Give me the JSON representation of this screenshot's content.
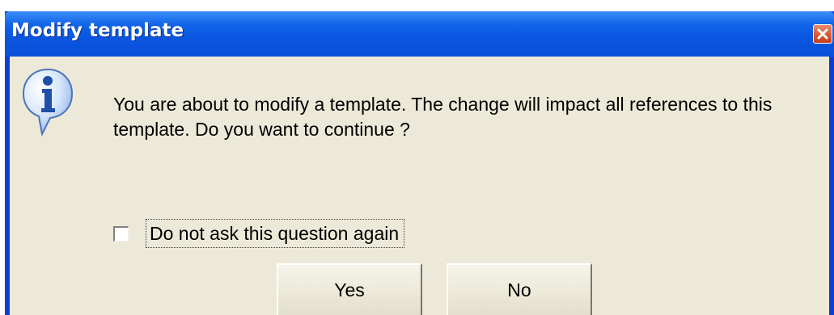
{
  "window": {
    "title": "Modify template",
    "close_icon": "close-icon",
    "accent_color": "#0a55e0",
    "close_color": "#d8532f",
    "background_color": "#ece9d8"
  },
  "message": {
    "icon": "info-icon",
    "text": "You are about to modify a template.  The change will impact all references to this template. Do you want to continue ?"
  },
  "option": {
    "checkbox_label": "Do not ask this question again",
    "checked": false
  },
  "buttons": {
    "yes_label": "Yes",
    "no_label": "No"
  }
}
